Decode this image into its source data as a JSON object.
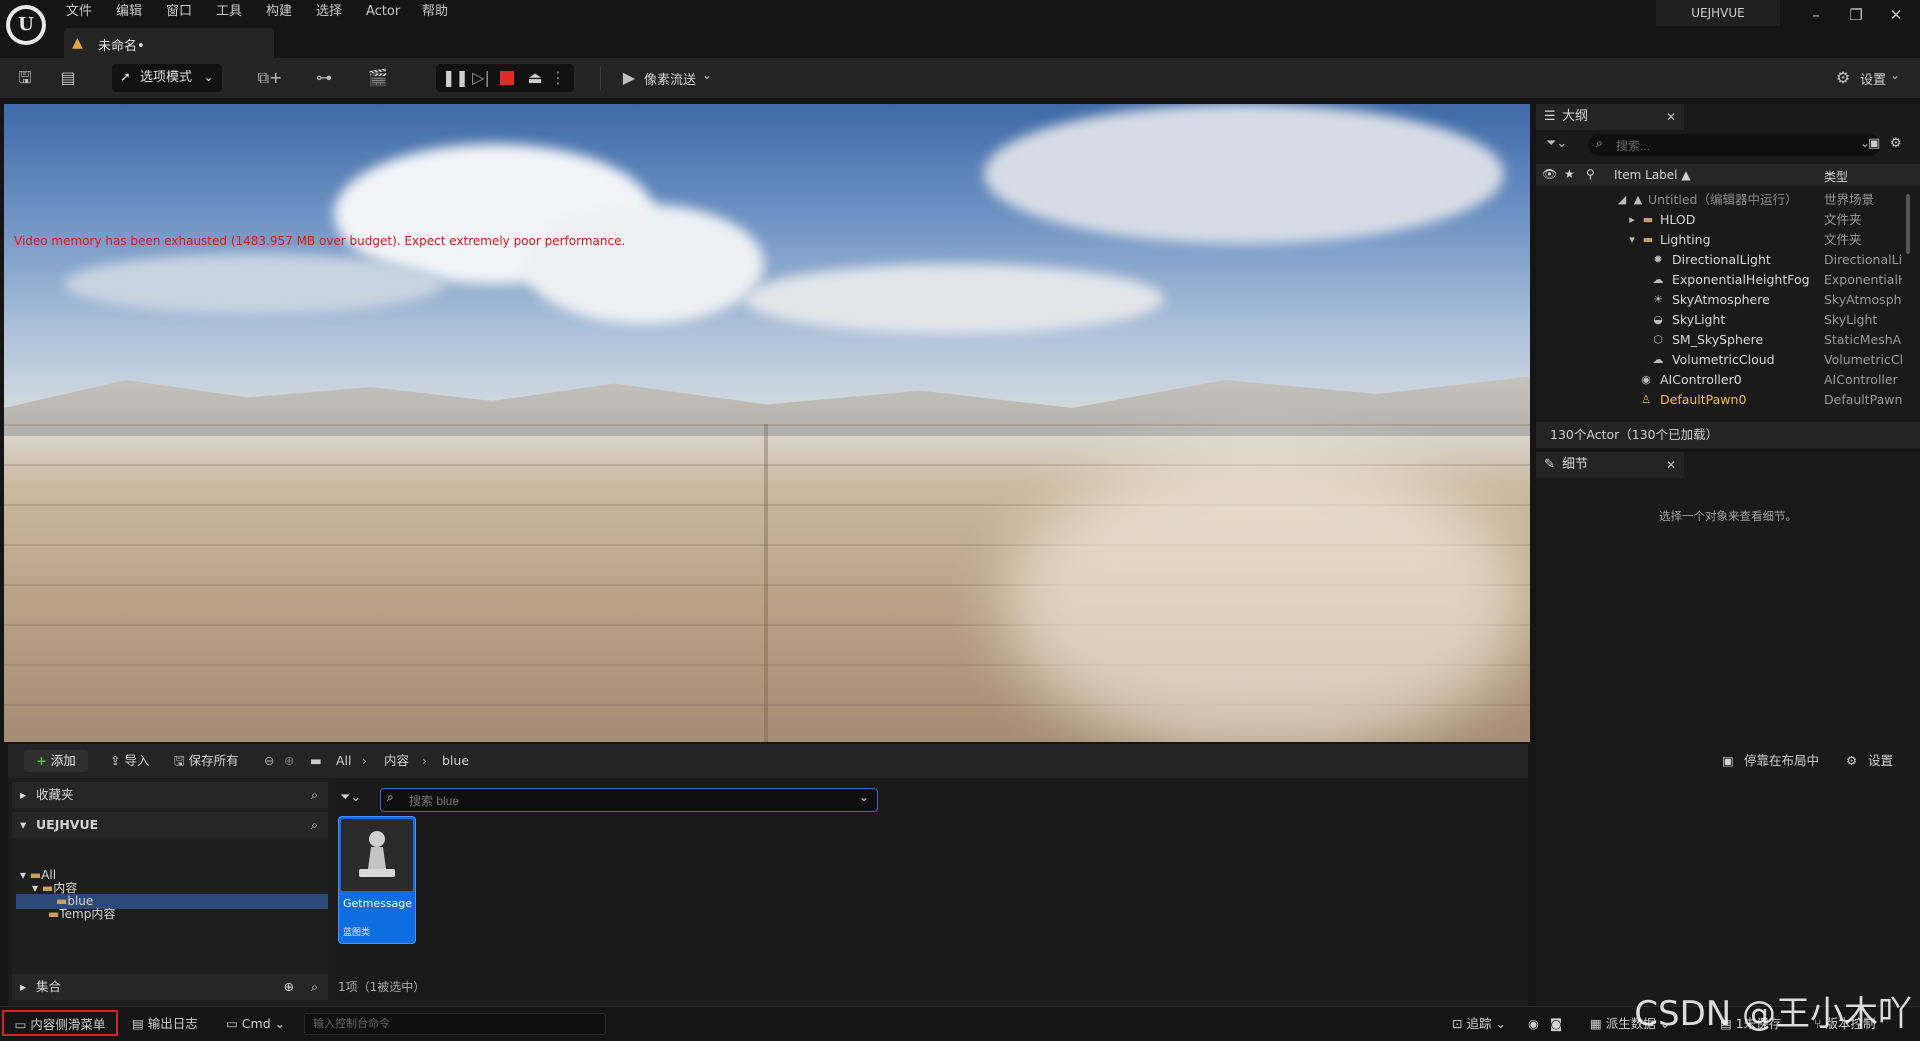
{
  "menu": {
    "items": [
      "文件",
      "编辑",
      "窗口",
      "工具",
      "构建",
      "选择",
      "Actor",
      "帮助"
    ],
    "project_name": "UEJHVUE",
    "doc_tab": "未命名•"
  },
  "toolbar": {
    "mode_label": "选项模式",
    "pixel_stream_label": "像素流送",
    "settings_label": "设置"
  },
  "viewport": {
    "warning": "Video memory has been exhausted (1483.957 MB over budget). Expect extremely poor performance.",
    "warning_color": "#d61b1b"
  },
  "outliner": {
    "tab_label": "大纲",
    "search_placeholder": "搜索...",
    "col_label": "Item Label ▲",
    "col_type": "类型",
    "rows": [
      {
        "name": "Untitled（编辑器中运行）",
        "type": "世界场景"
      },
      {
        "name": "HLOD",
        "type": "文件夹"
      },
      {
        "name": "Lighting",
        "type": "文件夹"
      },
      {
        "name": "DirectionalLight",
        "type": "DirectionalLig"
      },
      {
        "name": "ExponentialHeightFog",
        "type": "ExponentialH"
      },
      {
        "name": "SkyAtmosphere",
        "type": "SkyAtmosphe"
      },
      {
        "name": "SkyLight",
        "type": "SkyLight"
      },
      {
        "name": "SM_SkySphere",
        "type": "StaticMeshA"
      },
      {
        "name": "VolumetricCloud",
        "type": "VolumetricCl"
      },
      {
        "name": "AIController0",
        "type": "AIController"
      },
      {
        "name": "DefaultPawn0",
        "type": "DefaultPawn"
      }
    ],
    "footer": "130个Actor（130个已加载）"
  },
  "details": {
    "tab_label": "细节",
    "hint": "选择一个对象来查看细节。"
  },
  "content_browser": {
    "add_label": "添加",
    "import_label": "导入",
    "save_all_label": "保存所有",
    "breadcrumb": [
      "All",
      "内容",
      "blue"
    ],
    "dock_label": "停靠在布局中",
    "settings_label": "设置",
    "favorites_label": "收藏夹",
    "project_label": "UEJHVUE",
    "tree": [
      "All",
      "内容",
      "blue",
      "Temp内容"
    ],
    "collections_label": "集合",
    "search_placeholder": "搜索 blue",
    "asset": {
      "name": "Getmessage",
      "class": "蓝图类"
    },
    "count": "1项（1被选中）"
  },
  "statusbar": {
    "drawer_label": "内容侧滑菜单",
    "output_log_label": "输出日志",
    "cmd_label": "Cmd",
    "console_placeholder": "输入控制台命令",
    "trace_label": "追踪",
    "derived_data_label": "派生数据",
    "unsaved_label": "1未保存",
    "source_control_label": "版本控制"
  },
  "watermark": "CSDN @王小木吖"
}
